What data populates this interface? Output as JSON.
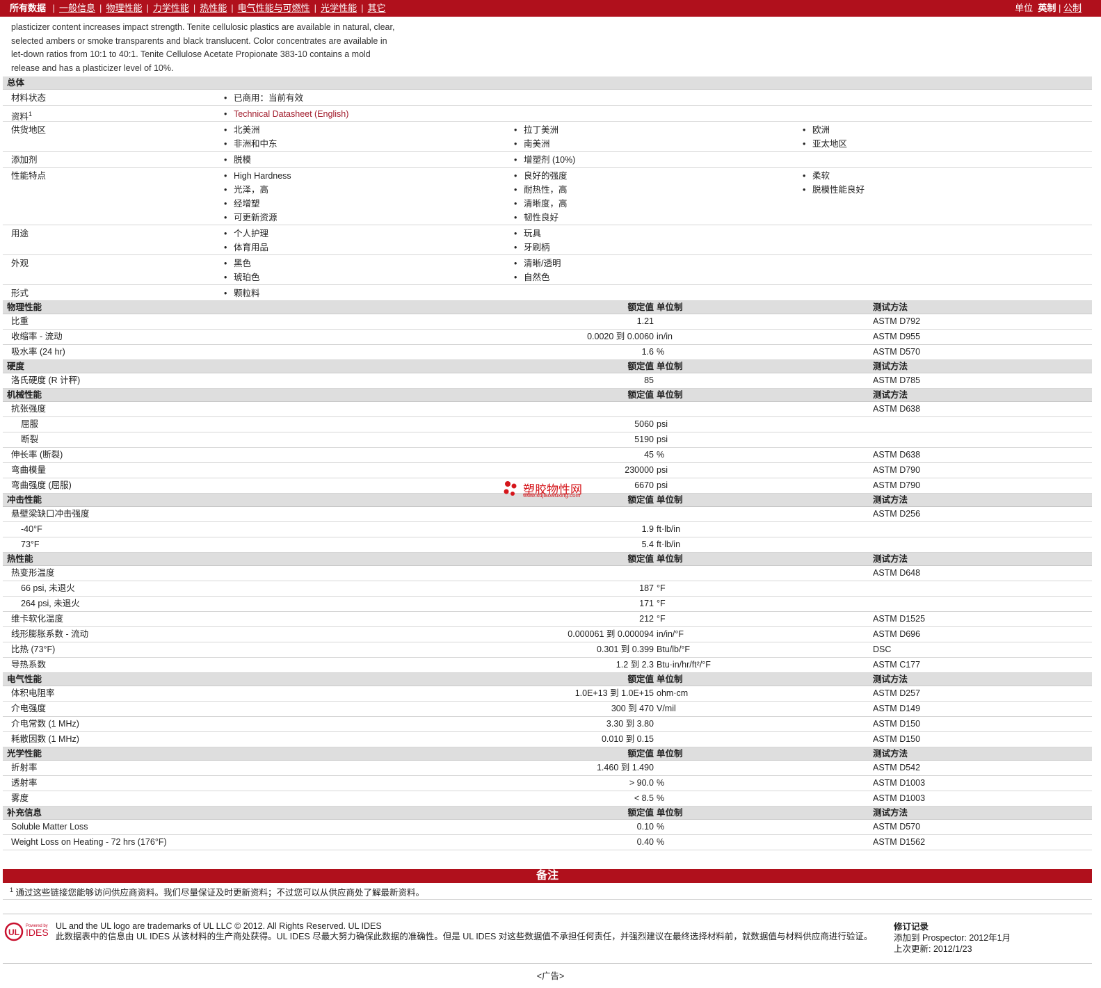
{
  "nav": {
    "all": "所有数据",
    "tabs": [
      "一般信息",
      "物理性能",
      "力学性能",
      "热性能",
      "电气性能与可燃性",
      "光学性能",
      "其它"
    ],
    "units_label": "单位",
    "imperial": "英制",
    "metric": "公制"
  },
  "description": "plasticizer content increases impact strength. Tenite cellulosic plastics are available in natural, clear, selected ambers or smoke transparents and black translucent. Color concentrates are available in let-down ratios from 10:1 to 40:1. Tenite Cellulose Acetate Propionate 383-10 contains a mold release and has a plasticizer level of 10%.",
  "general": {
    "title": "总体",
    "rows": [
      {
        "label": "材料状态",
        "c1": [
          "已商用：当前有效"
        ],
        "c2": [],
        "c3": []
      },
      {
        "label": "资料",
        "sup": "1",
        "c1": [
          "Technical Datasheet (English)"
        ],
        "c2": [],
        "c3": [],
        "link": true
      },
      {
        "label": "供货地区",
        "c1": [
          "北美洲",
          "非洲和中东"
        ],
        "c2": [
          "拉丁美洲",
          "南美洲"
        ],
        "c3": [
          "欧洲",
          "亚太地区"
        ]
      },
      {
        "label": "添加剂",
        "c1": [
          "脱模"
        ],
        "c2": [
          "增塑剂 (10%)"
        ],
        "c3": []
      },
      {
        "label": "性能特点",
        "c1": [
          "High Hardness",
          "光泽，高",
          "经增塑",
          "可更新资源"
        ],
        "c2": [
          "良好的强度",
          "耐热性，高",
          "清晰度，高",
          "韧性良好"
        ],
        "c3": [
          "柔软",
          "脱模性能良好"
        ]
      },
      {
        "label": "用途",
        "c1": [
          "个人护理",
          "体育用品"
        ],
        "c2": [
          "玩具",
          "牙刷柄"
        ],
        "c3": []
      },
      {
        "label": "外观",
        "c1": [
          "黑色",
          "琥珀色"
        ],
        "c2": [
          "清晰/透明",
          "自然色"
        ],
        "c3": []
      },
      {
        "label": "形式",
        "c1": [
          "颗粒料"
        ],
        "c2": [],
        "c3": []
      }
    ]
  },
  "headers": {
    "nominal": "额定值",
    "unit": "单位制",
    "test": "测试方法"
  },
  "sections": [
    {
      "title": "物理性能",
      "rows": [
        {
          "label": "比重",
          "value": "1.21",
          "unit": "",
          "test": "ASTM D792"
        },
        {
          "label": "收缩率 - 流动",
          "value": "0.0020 到  0.0060",
          "unit": "in/in",
          "test": "ASTM D955"
        },
        {
          "label": "吸水率 (24 hr)",
          "value": "1.6",
          "unit": "%",
          "test": "ASTM D570"
        }
      ]
    },
    {
      "title": "硬度",
      "rows": [
        {
          "label": "洛氏硬度 (R 计秤)",
          "value": "85",
          "unit": "",
          "test": "ASTM D785"
        }
      ]
    },
    {
      "title": "机械性能",
      "rows": [
        {
          "label": "抗张强度",
          "value": "",
          "unit": "",
          "test": "ASTM D638"
        },
        {
          "label": "屈服",
          "value": "5060",
          "unit": "psi",
          "test": "",
          "sub": true
        },
        {
          "label": "断裂",
          "value": "5190",
          "unit": "psi",
          "test": "",
          "sub": true
        },
        {
          "label": "伸长率 (断裂)",
          "value": "45",
          "unit": "%",
          "test": "ASTM D638"
        },
        {
          "label": "弯曲模量",
          "value": "230000",
          "unit": "psi",
          "test": "ASTM D790"
        },
        {
          "label": "弯曲强度 (屈服)",
          "value": "6670",
          "unit": "psi",
          "test": "ASTM D790"
        }
      ]
    },
    {
      "title": "冲击性能",
      "rows": [
        {
          "label": "悬壁梁缺口冲击强度",
          "value": "",
          "unit": "",
          "test": "ASTM D256"
        },
        {
          "label": "-40°F",
          "value": "1.9",
          "unit": "ft·lb/in",
          "test": "",
          "sub": true
        },
        {
          "label": "73°F",
          "value": "5.4",
          "unit": "ft·lb/in",
          "test": "",
          "sub": true
        }
      ]
    },
    {
      "title": "热性能",
      "rows": [
        {
          "label": "热变形温度",
          "value": "",
          "unit": "",
          "test": "ASTM D648"
        },
        {
          "label": "66 psi, 未退火",
          "value": "187",
          "unit": "°F",
          "test": "",
          "sub": true
        },
        {
          "label": "264 psi, 未退火",
          "value": "171",
          "unit": "°F",
          "test": "",
          "sub": true
        },
        {
          "label": "维卡软化温度",
          "value": "212",
          "unit": "°F",
          "test": "ASTM D1525"
        },
        {
          "label": "线形膨胀系数 - 流动",
          "value": "0.000061 到  0.000094",
          "unit": "in/in/°F",
          "test": "ASTM D696"
        },
        {
          "label": "比热 (73°F)",
          "value": "0.301 到  0.399",
          "unit": "Btu/lb/°F",
          "test": "DSC"
        },
        {
          "label": "导热系数",
          "value": "1.2 到  2.3",
          "unit": "Btu·in/hr/ft²/°F",
          "test": "ASTM C177"
        }
      ]
    },
    {
      "title": "电气性能",
      "rows": [
        {
          "label": "体积电阻率",
          "value": "1.0E+13 到  1.0E+15",
          "unit": "ohm·cm",
          "test": "ASTM D257"
        },
        {
          "label": "介电强度",
          "value": "300 到  470",
          "unit": "V/mil",
          "test": "ASTM D149"
        },
        {
          "label": "介电常数 (1 MHz)",
          "value": "3.30 到  3.80",
          "unit": "",
          "test": "ASTM D150"
        },
        {
          "label": "耗散因数 (1 MHz)",
          "value": "0.010 到  0.15",
          "unit": "",
          "test": "ASTM D150"
        }
      ]
    },
    {
      "title": "光学性能",
      "rows": [
        {
          "label": "折射率",
          "value": "1.460 到  1.490",
          "unit": "",
          "test": "ASTM D542"
        },
        {
          "label": "透射率",
          "value": "> 90.0",
          "unit": "%",
          "test": "ASTM D1003"
        },
        {
          "label": "雾度",
          "value": "< 8.5",
          "unit": "%",
          "test": "ASTM D1003"
        }
      ]
    },
    {
      "title": "补充信息",
      "rows": [
        {
          "label": "Soluble Matter Loss",
          "value": "0.10",
          "unit": "%",
          "test": "ASTM D570"
        },
        {
          "label": "Weight Loss on Heating - 72 hrs (176°F)",
          "value": "0.40",
          "unit": "%",
          "test": "ASTM D1562"
        }
      ]
    }
  ],
  "notes": {
    "title": "备注",
    "footnote_num": "1",
    "footnote": "通过这些链接您能够访问供应商资料。我们尽量保证及时更新资料；不过您可以从供应商处了解最新资料。"
  },
  "footer": {
    "logo_text": "IDES",
    "logo_powered": "Powered by",
    "legal1": "UL and the UL logo are trademarks of UL LLC © 2012. All Rights Reserved. UL IDES",
    "legal2": "此数据表中的信息由 UL IDES 从该材料的生产商处获得。UL IDES 尽最大努力确保此数据的准确性。但是 UL IDES 对这些数据值不承担任何责任，并强烈建议在最终选择材料前，就数据值与材料供应商进行验证。",
    "rev_title": "修订记录",
    "rev_added": "添加到 Prospector: 2012年1月",
    "rev_updated": "上次更新: 2012/1/23",
    "ad": "<广告>"
  },
  "watermark": {
    "text": "塑胶物性网",
    "url": "www.sujiaowuxing.com"
  },
  "colors": {
    "brand_red": "#b0101c",
    "link_red": "#a11a2a",
    "section_gray": "#dedede"
  }
}
